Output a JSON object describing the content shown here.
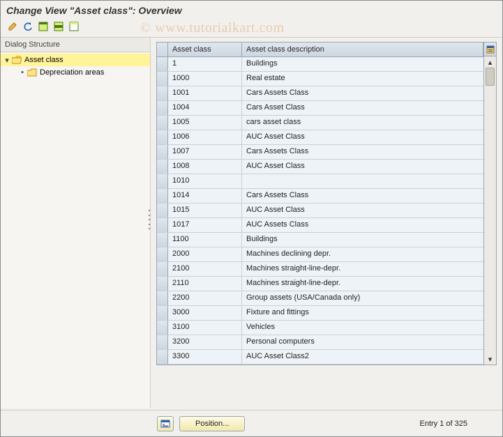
{
  "title": "Change View \"Asset class\": Overview",
  "watermark": "© www.tutorialkart.com",
  "toolbar": {
    "items": [
      {
        "name": "change-icon"
      },
      {
        "name": "undo-icon"
      },
      {
        "name": "select-all-icon"
      },
      {
        "name": "select-block-icon"
      },
      {
        "name": "deselect-all-icon"
      }
    ]
  },
  "sidebar": {
    "heading": "Dialog Structure",
    "tree": {
      "root": {
        "label": "Asset class",
        "expanded": true,
        "selected": true
      },
      "child": {
        "label": "Depreciation areas",
        "expanded": false,
        "selected": false
      }
    }
  },
  "table": {
    "columns": {
      "asset_class": "Asset class",
      "description": "Asset class description"
    },
    "rows": [
      {
        "ac": "1",
        "desc": "Buildings"
      },
      {
        "ac": "1000",
        "desc": "Real estate"
      },
      {
        "ac": "1001",
        "desc": "Cars Assets Class"
      },
      {
        "ac": "1004",
        "desc": "Cars Asset Class"
      },
      {
        "ac": "1005",
        "desc": "cars asset class"
      },
      {
        "ac": "1006",
        "desc": "AUC Asset Class"
      },
      {
        "ac": "1007",
        "desc": "Cars Assets Class"
      },
      {
        "ac": "1008",
        "desc": "AUC Asset Class"
      },
      {
        "ac": "1010",
        "desc": ""
      },
      {
        "ac": "1014",
        "desc": "Cars Assets Class"
      },
      {
        "ac": "1015",
        "desc": "AUC Asset Class"
      },
      {
        "ac": "1017",
        "desc": "AUC Assets Class"
      },
      {
        "ac": "1100",
        "desc": "Buildings"
      },
      {
        "ac": "2000",
        "desc": "Machines declining depr."
      },
      {
        "ac": "2100",
        "desc": "Machines straight-line-depr."
      },
      {
        "ac": "2110",
        "desc": "Machines straight-line-depr."
      },
      {
        "ac": "2200",
        "desc": "Group assets (USA/Canada only)"
      },
      {
        "ac": "3000",
        "desc": "Fixture and fittings"
      },
      {
        "ac": "3100",
        "desc": "Vehicles"
      },
      {
        "ac": "3200",
        "desc": "Personal computers"
      },
      {
        "ac": "3300",
        "desc": "AUC Asset Class2"
      }
    ]
  },
  "footer": {
    "position_label": "Position...",
    "entry_text": "Entry 1 of 325"
  }
}
